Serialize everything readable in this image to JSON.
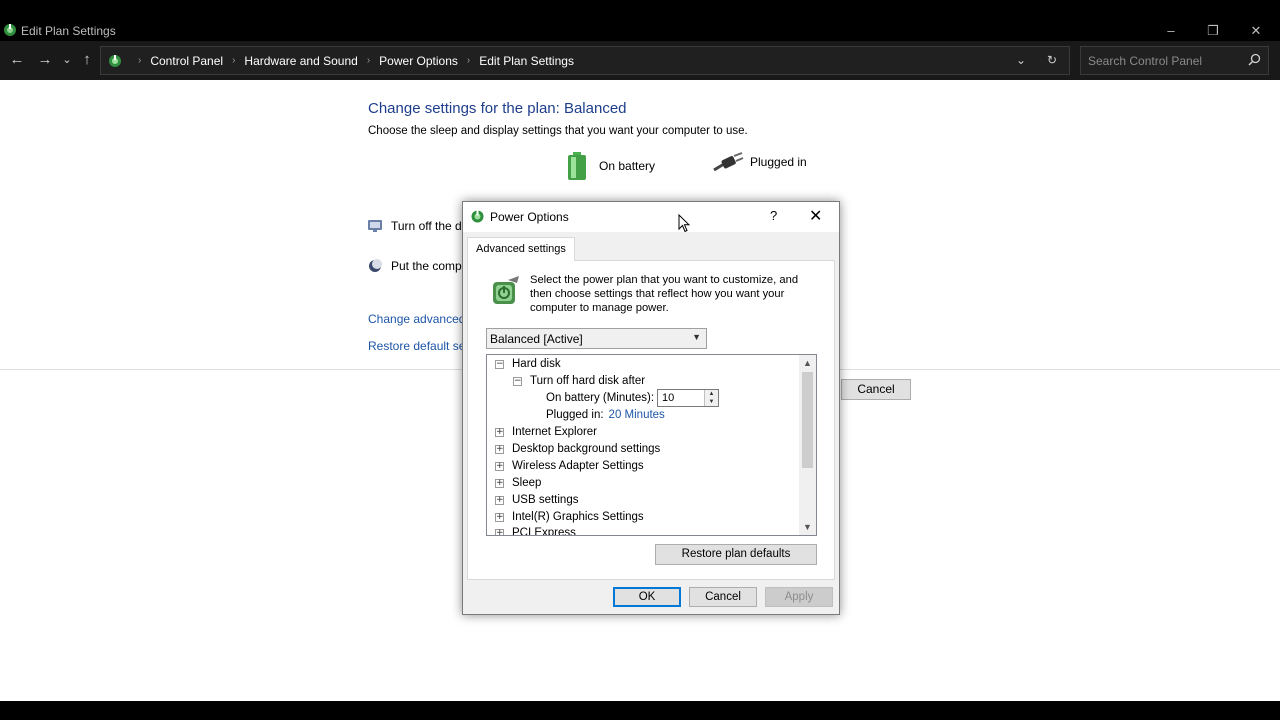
{
  "window": {
    "title": "Edit Plan Settings",
    "controls": {
      "minimize": "–",
      "maximize": "❐",
      "close": "✕"
    }
  },
  "nav": {
    "back": "←",
    "forward": "→",
    "recent": "⌄",
    "up": "↑"
  },
  "address": {
    "crumbs": [
      "Control Panel",
      "Hardware and Sound",
      "Power Options",
      "Edit Plan Settings"
    ],
    "dropdown": "⌄",
    "refresh": "↻"
  },
  "search": {
    "placeholder": "Search Control Panel"
  },
  "plan_page": {
    "title": "Change settings for the plan: Balanced",
    "description": "Choose the sleep and display settings that you want your computer to use.",
    "col_battery": "On battery",
    "col_plugged": "Plugged in",
    "row_display": "Turn off the di",
    "row_sleep": "Put the compu",
    "link_advanced": "Change advanced p",
    "link_restore": "Restore default sett",
    "cancel": "Cancel"
  },
  "dialog": {
    "title": "Power Options",
    "help": "?",
    "close": "✕",
    "tab": "Advanced settings",
    "intro": "Select the power plan that you want to customize, and then choose settings that reflect how you want your computer to manage power.",
    "plan_select": {
      "value": "Balanced [Active]"
    },
    "tree": {
      "hard_disk": {
        "label": "Hard disk",
        "toggle": "−"
      },
      "turn_off": {
        "label": "Turn off hard disk after",
        "toggle": "−"
      },
      "on_battery": {
        "label": "On battery (Minutes):",
        "value": "10"
      },
      "plugged_in": {
        "label": "Plugged in:",
        "value": "20 Minutes"
      },
      "items": [
        {
          "label": "Internet Explorer",
          "toggle": "+"
        },
        {
          "label": "Desktop background settings",
          "toggle": "+"
        },
        {
          "label": "Wireless Adapter Settings",
          "toggle": "+"
        },
        {
          "label": "Sleep",
          "toggle": "+"
        },
        {
          "label": "USB settings",
          "toggle": "+"
        },
        {
          "label": "Intel(R) Graphics Settings",
          "toggle": "+"
        },
        {
          "label": "PCI Express",
          "toggle": "+"
        }
      ]
    },
    "restore_defaults": "Restore plan defaults",
    "ok": "OK",
    "cancel": "Cancel",
    "apply": "Apply"
  },
  "colors": {
    "title_blue": "#1e3e8c",
    "link_blue": "#1e56a8",
    "focus_blue": "#0078d7",
    "dark_chrome": "#191919"
  },
  "icons": [
    "power-options-icon",
    "battery-icon",
    "plug-icon",
    "monitor-icon",
    "moon-icon",
    "search-icon",
    "refresh-icon"
  ]
}
